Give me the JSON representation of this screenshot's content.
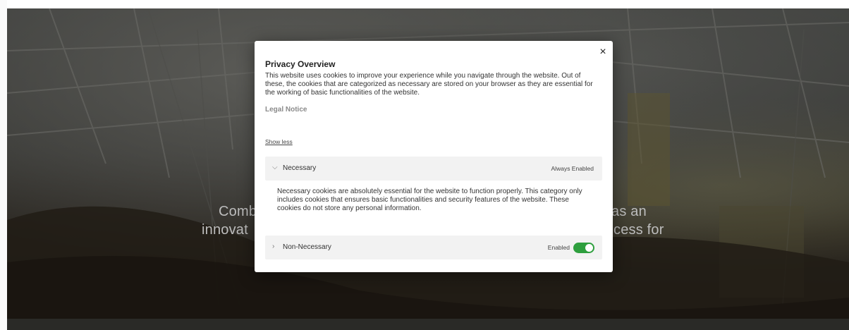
{
  "hero": {
    "line1_left": "Comb",
    "line1_right": "as an",
    "line2_left": "innovat",
    "line2_right": "cess for"
  },
  "modal": {
    "close_icon": "×",
    "title": "Privacy Overview",
    "description": "This website uses cookies to improve your experience while you navigate through the website. Out of these, the cookies that are categorized as necessary are stored on your browser as they are essential for the working of basic functionalities of the website.",
    "legal_link": "Legal Notice",
    "show_less": "Show less",
    "sections": {
      "necessary": {
        "chevron_icon": "chevron-down-icon",
        "label": "Necessary",
        "status": "Always Enabled",
        "description": "Necessary cookies are absolutely essential for the website to function properly. This category only includes cookies that ensures basic functionalities and security features of the website. These cookies do not store any personal information."
      },
      "non_necessary": {
        "chevron_icon": "chevron-right-icon",
        "label": "Non-Necessary",
        "status": "Enabled",
        "toggle_on": true,
        "toggle_color": "#2e9f3e"
      }
    }
  }
}
